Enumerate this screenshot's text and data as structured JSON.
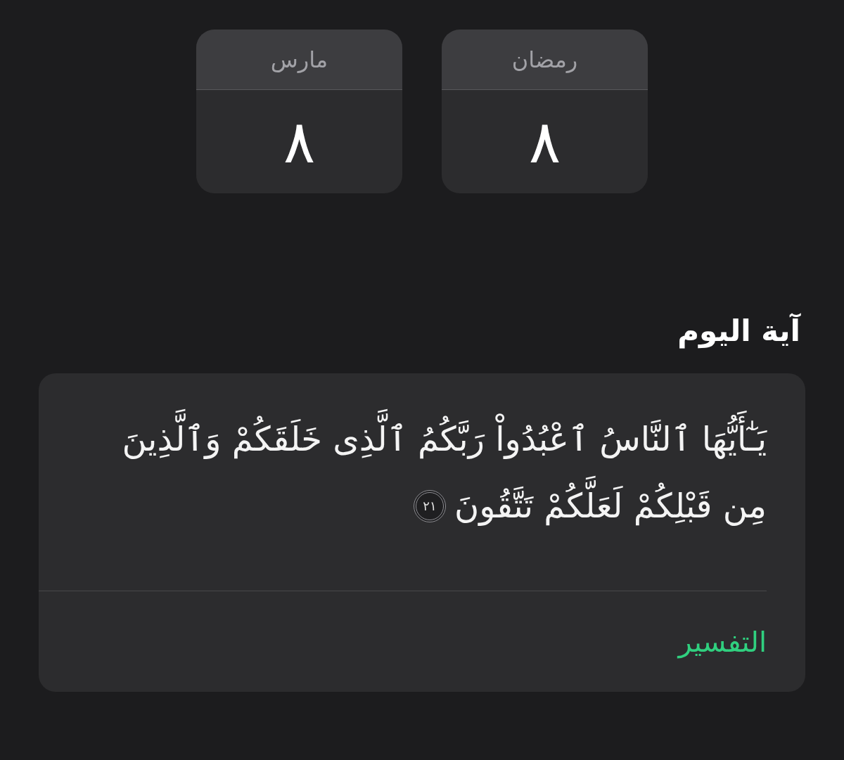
{
  "date_cards": [
    {
      "month": "رمضان",
      "day": "٨"
    },
    {
      "month": "مارس",
      "day": "٨"
    }
  ],
  "verse_of_the_day": {
    "title": "آية اليوم",
    "verse_lines": [
      "يَـٰٓأَيُّهَا ٱلنَّاسُ ٱعْبُدُواْ رَبَّكُمُ ٱلَّذِى خَلَقَكُمْ وَٱلَّذِينَ",
      "مِن قَبْلِكُمْ لَعَلَّكُمْ تَتَّقُونَ"
    ],
    "verse_number": "٢١",
    "link": "التفسير"
  }
}
